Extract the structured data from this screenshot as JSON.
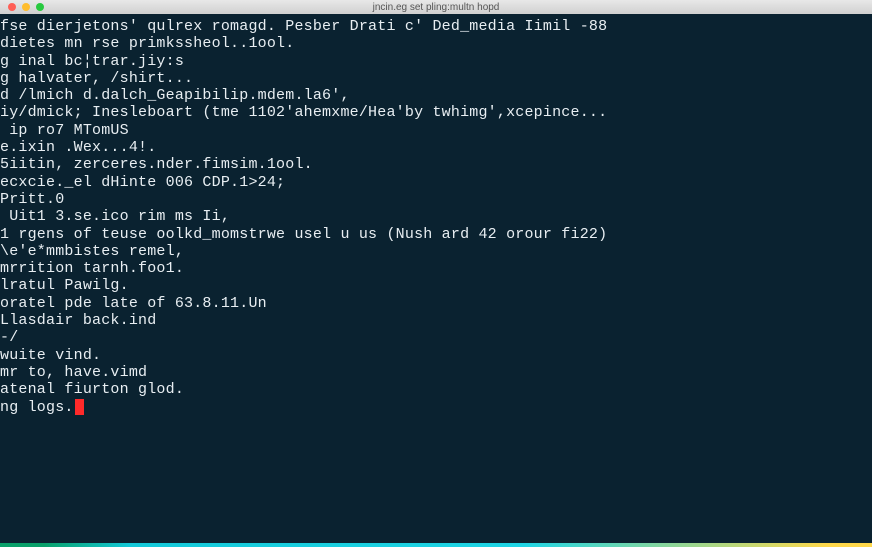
{
  "window": {
    "title": "jncin.eg set pling:multn hopd"
  },
  "terminal": {
    "lines": [
      "fse dierjetons' qulrex romagd. Pesber Drati c' Ded_media Iimil -88",
      "dietes mn rse primkssheol..1ool.",
      "g inal bc¦trar.jiy:s",
      "g halvater, /shirt...",
      "d /lmich d.dalch_Geapibilip.mdem.la6',",
      "iy/dmick; Inesleboart (tme 1102'ahemxme/Hea'by twhimg',xcepince...",
      " ip ro7 MTomUS",
      "e.ixin .Wex...4!.",
      "5iitin, zerceres.nder.fimsim.1ool.",
      "",
      "ecxcie._el dHinte 006 CDP.1>24;",
      "",
      "Pritt.0",
      " Uit1 3.se.ico rim ms Ii,",
      "1 rgens of teuse oolkd_momstrwe usel u us (Nush ard 42 orour fi22)",
      "\\e'e*mmbistes remel,",
      "",
      "mrrition tarnh.foo1.",
      "",
      "lratul Pawilg.",
      "",
      "oratel pde late of 63.8.11.Un",
      "",
      "Llasdair back.ind",
      "-/",
      "",
      "wuite vind.",
      "mr to, have.vimd",
      "atenal fiurton glod."
    ],
    "last_line_prefix": "ng logs."
  }
}
